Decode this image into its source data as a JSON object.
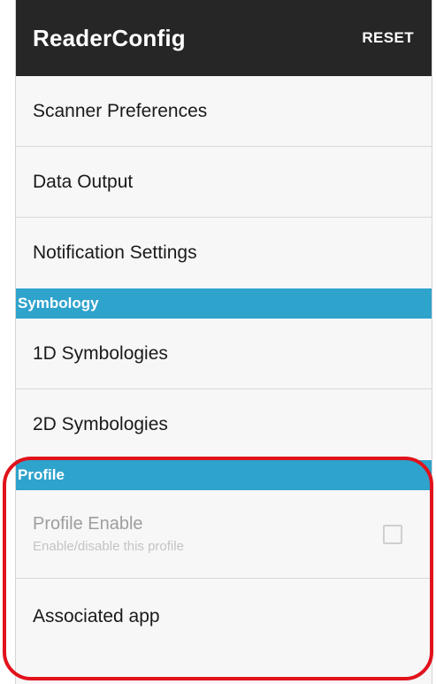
{
  "app_bar": {
    "title": "ReaderConfig",
    "reset_label": "RESET"
  },
  "general": {
    "items": [
      {
        "label": "Scanner Preferences"
      },
      {
        "label": "Data Output"
      },
      {
        "label": "Notification Settings"
      }
    ]
  },
  "symbology": {
    "header": "Symbology",
    "items": [
      {
        "label": "1D Symbologies"
      },
      {
        "label": "2D Symbologies"
      }
    ]
  },
  "profile": {
    "header": "Profile",
    "enable": {
      "title": "Profile Enable",
      "summary": "Enable/disable this profile",
      "checked": false,
      "enabled": false
    },
    "associated_app_label": "Associated app"
  },
  "colors": {
    "app_bar": "#262626",
    "category_header": "#2ea3cc",
    "highlight": "#e1121b",
    "background": "#f7f7f7"
  }
}
